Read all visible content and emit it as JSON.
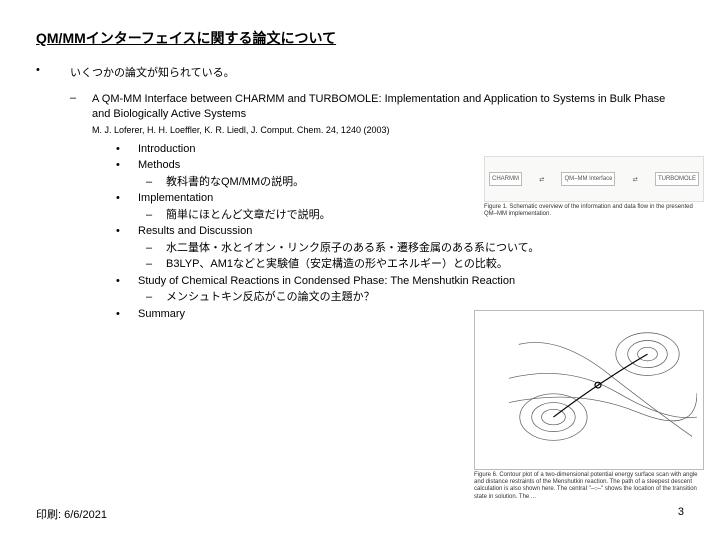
{
  "title": "QM/MMインターフェイスに関する論文について",
  "intro": "いくつかの論文が知られている。",
  "paper": {
    "title": "A QM-MM Interface between CHARMM and TURBOMOLE: Implementation and Application to Systems in Bulk Phase and Biologically Active Systems",
    "citation": "M. J. Loferer, H. H. Loeffler, K. R. Liedl, J. Comput. Chem. 24, 1240 (2003)"
  },
  "sections": {
    "s1": "Introduction",
    "s2": "Methods",
    "s2a": "教科書的なQM/MMの説明。",
    "s3": "Implementation",
    "s3a": "簡単にほとんど文章だけで説明。",
    "s4": "Results and Discussion",
    "s4a": "水二量体・水とイオン・リンク原子のある系・遷移金属のある系について。",
    "s4b": "B3LYP、AM1などと実験値（安定構造の形やエネルギー）との比較。",
    "s5": "Study of Chemical Reactions in Condensed Phase: The Menshutkin Reaction",
    "s5a": "メンシュトキン反応がこの論文の主題か？",
    "s6": "Summary"
  },
  "fig1": {
    "left": "CHARMM",
    "mid": "QM–MM Interface",
    "right": "TURBOMOLE",
    "caption": "Figure 1. Schematic overview of the information and data flow in the presented QM–MM implementation."
  },
  "fig2": {
    "caption": "Figure 6. Contour plot of a two-dimensional potential energy surface scan with angle and distance restraints of the Menshutkin reaction. The path of a steepest descent calculation is also shown here. The central \"–○–\" shows the location of the transition state in solution. The ..."
  },
  "footer": {
    "left": "印刷: 6/6/2021",
    "right": "3"
  }
}
